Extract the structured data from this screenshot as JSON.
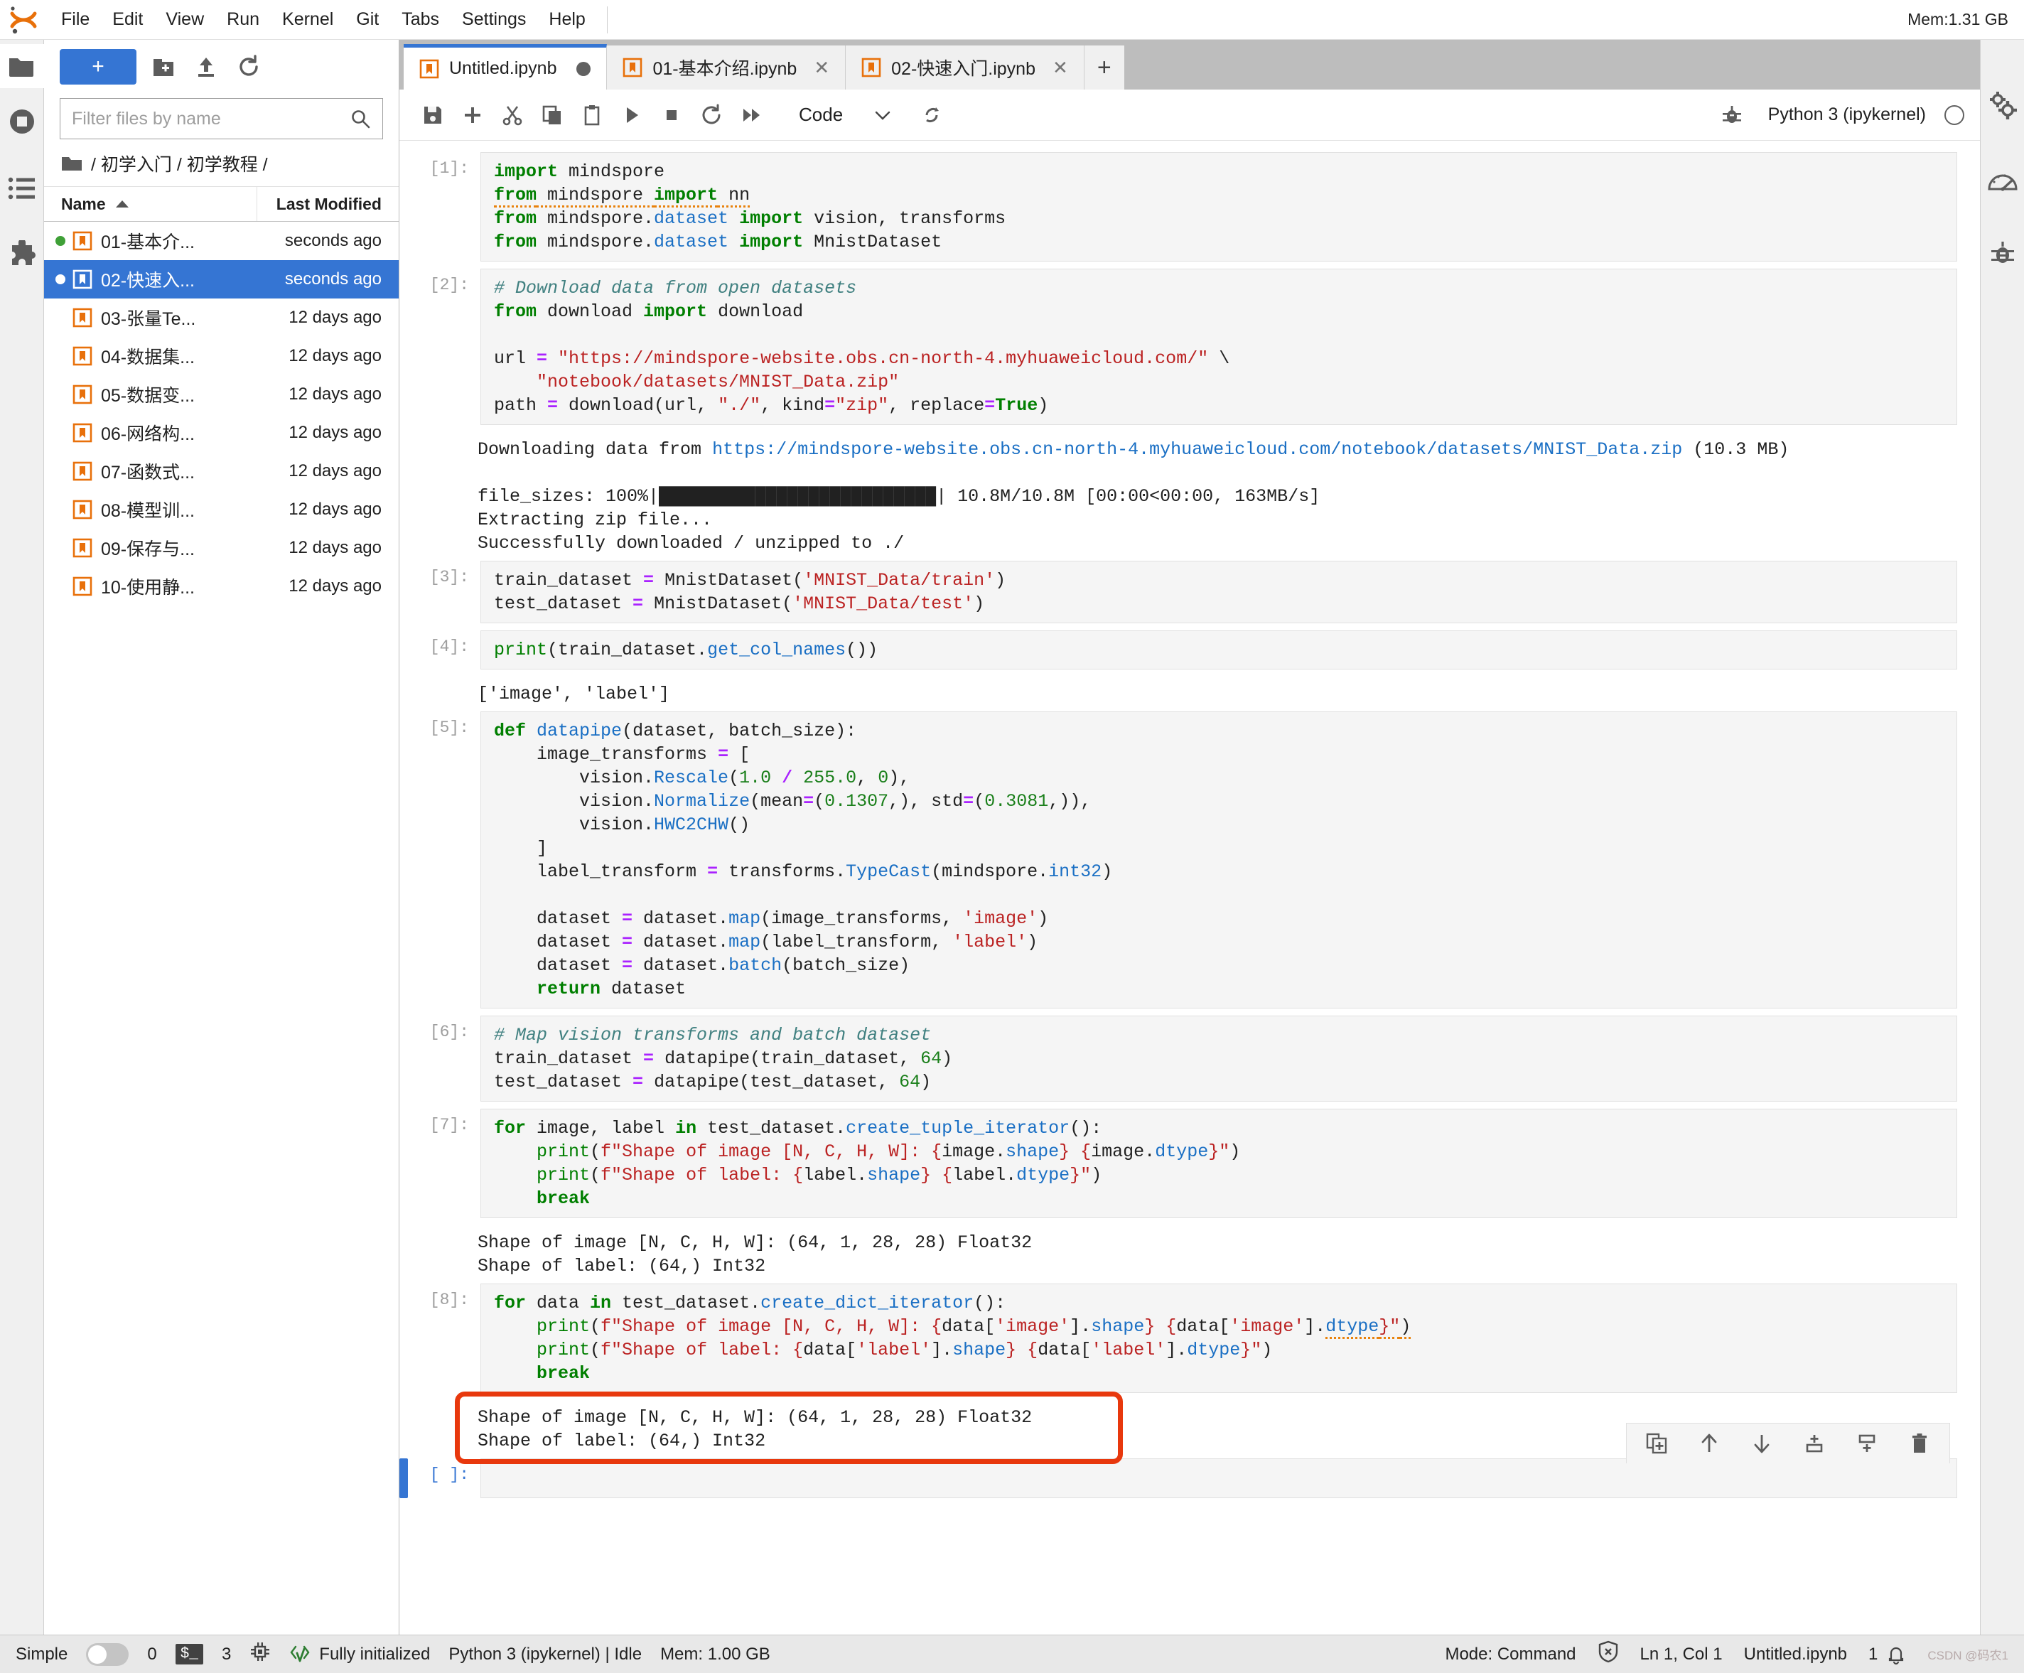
{
  "app": {
    "logo": "jupyter-logo",
    "memory_top": "Mem:1.31 GB"
  },
  "menubar": {
    "items": [
      {
        "label": "File"
      },
      {
        "label": "Edit"
      },
      {
        "label": "View"
      },
      {
        "label": "Run"
      },
      {
        "label": "Kernel"
      },
      {
        "label": "Git"
      },
      {
        "label": "Tabs"
      },
      {
        "label": "Settings"
      },
      {
        "label": "Help"
      }
    ]
  },
  "activitybar": {
    "items": [
      {
        "name": "file-browser-icon",
        "label": "File Browser"
      },
      {
        "name": "running-sessions-icon",
        "label": "Running Terminals and Kernels"
      },
      {
        "name": "table-of-contents-icon",
        "label": "Table of Contents"
      },
      {
        "name": "extension-manager-icon",
        "label": "Extension Manager"
      }
    ]
  },
  "rightbar": {
    "items": [
      {
        "name": "property-inspector-icon",
        "label": "Property Inspector"
      },
      {
        "name": "performance-gauge-icon",
        "label": "Performance"
      },
      {
        "name": "debugger-icon",
        "label": "Debugger"
      }
    ]
  },
  "filebrowser": {
    "new_launcher_label": "+",
    "toolbar_icons": [
      {
        "name": "new-folder-icon"
      },
      {
        "name": "upload-icon"
      },
      {
        "name": "refresh-icon"
      }
    ],
    "filter": {
      "placeholder": "Filter files by name",
      "value": ""
    },
    "breadcrumb": "/ 初学入门 / 初学教程 /",
    "columns": {
      "name": "Name",
      "modified": "Last Modified"
    },
    "sort_indicator": "ascending",
    "files": [
      {
        "name": "01-基本介...",
        "modified": "seconds ago",
        "running": true,
        "selected": false
      },
      {
        "name": "02-快速入...",
        "modified": "seconds ago",
        "running": true,
        "selected": true
      },
      {
        "name": "03-张量Te...",
        "modified": "12 days ago",
        "running": false,
        "selected": false
      },
      {
        "name": "04-数据集...",
        "modified": "12 days ago",
        "running": false,
        "selected": false
      },
      {
        "name": "05-数据变...",
        "modified": "12 days ago",
        "running": false,
        "selected": false
      },
      {
        "name": "06-网络构...",
        "modified": "12 days ago",
        "running": false,
        "selected": false
      },
      {
        "name": "07-函数式...",
        "modified": "12 days ago",
        "running": false,
        "selected": false
      },
      {
        "name": "08-模型训...",
        "modified": "12 days ago",
        "running": false,
        "selected": false
      },
      {
        "name": "09-保存与...",
        "modified": "12 days ago",
        "running": false,
        "selected": false
      },
      {
        "name": "10-使用静...",
        "modified": "12 days ago",
        "running": false,
        "selected": false
      }
    ]
  },
  "tabs": [
    {
      "label": "Untitled.ipynb",
      "active": true,
      "dirty": true,
      "closable": false
    },
    {
      "label": "01-基本介绍.ipynb",
      "active": false,
      "dirty": false,
      "closable": true
    },
    {
      "label": "02-快速入门.ipynb",
      "active": false,
      "dirty": false,
      "closable": true
    }
  ],
  "tab_add_label": "+",
  "notebook_toolbar": {
    "icons": [
      {
        "name": "save-icon"
      },
      {
        "name": "add-cell-icon"
      },
      {
        "name": "cut-icon"
      },
      {
        "name": "copy-icon"
      },
      {
        "name": "paste-icon"
      },
      {
        "name": "run-icon"
      },
      {
        "name": "stop-icon"
      },
      {
        "name": "restart-kernel-icon"
      },
      {
        "name": "restart-and-run-all-icon"
      }
    ],
    "celltype": "Code",
    "celltype_caret": "chevron-down-icon",
    "git_icon": "git-branch-icon",
    "debug_icon": "debugger-bug-icon",
    "kernel_name": "Python 3 (ipykernel)",
    "kernel_status": "idle"
  },
  "cells": [
    {
      "prompt": "[1]:",
      "source_html": "<span class=\"k\">import</span> mindspore\n<span class=\"k sq\">from</span><span class=\"sq\"> mindspore </span><span class=\"k sq\">import</span><span class=\"sq\"> nn</span>\n<span class=\"k\">from</span> mindspore.<span class=\"n\">dataset</span> <span class=\"k\">import</span> vision, transforms\n<span class=\"k\">from</span> mindspore.<span class=\"n\">dataset</span> <span class=\"k\">import</span> MnistDataset",
      "source_text": "import mindspore\nfrom mindspore import nn\nfrom mindspore.dataset import vision, transforms\nfrom mindspore.dataset import MnistDataset",
      "outputs": []
    },
    {
      "prompt": "[2]:",
      "source_html": "<span class=\"c\"># Download data from open datasets</span>\n<span class=\"k\">from</span> download <span class=\"k\">import</span> download\n\nurl <span class=\"o\">=</span> <span class=\"s\">\"https://mindspore-website.obs.cn-north-4.myhuaweicloud.com/\"</span> \\\n    <span class=\"s\">\"notebook/datasets/MNIST_Data.zip\"</span>\npath <span class=\"o\">=</span> download(url, <span class=\"s\">\"./\"</span>, kind<span class=\"o\">=</span><span class=\"s\">\"zip\"</span>, replace<span class=\"o\">=</span><span class=\"k\">True</span>)",
      "source_text": "# Download data from open datasets\nfrom download import download\n\nurl = \"https://mindspore-website.obs.cn-north-4.myhuaweicloud.com/\" \\\n    \"notebook/datasets/MNIST_Data.zip\"\npath = download(url, \"./\", kind=\"zip\", replace=True)",
      "outputs": [
        {
          "html": "Downloading data from <span class=\"lnk\">https://mindspore-website.obs.cn-north-4.myhuaweicloud.com/notebook/datasets/MNIST_Data.zip</span> (10.3 MB)\n\nfile_sizes: 100%|██████████████████████████| 10.8M/10.8M [00:00&lt;00:00, 163MB/s]\nExtracting zip file...\nSuccessfully downloaded / unzipped to ./",
          "text": "Downloading data from https://mindspore-website.obs.cn-north-4.myhuaweicloud.com/notebook/datasets/MNIST_Data.zip (10.3 MB)\n\nfile_sizes: 100%|██████████████████████████| 10.8M/10.8M [00:00<00:00, 163MB/s]\nExtracting zip file...\nSuccessfully downloaded / unzipped to ./"
        }
      ]
    },
    {
      "prompt": "[3]:",
      "source_html": "train_dataset <span class=\"o\">=</span> MnistDataset(<span class=\"s\">'MNIST_Data/train'</span>)\ntest_dataset <span class=\"o\">=</span> MnistDataset(<span class=\"s\">'MNIST_Data/test'</span>)",
      "source_text": "train_dataset = MnistDataset('MNIST_Data/train')\ntest_dataset = MnistDataset('MNIST_Data/test')",
      "outputs": []
    },
    {
      "prompt": "[4]:",
      "source_html": "<span class=\"kn\">print</span>(train_dataset.<span class=\"n\">get_col_names</span>())",
      "source_text": "print(train_dataset.get_col_names())",
      "outputs": [
        {
          "html": "['image', 'label']",
          "text": "['image', 'label']"
        }
      ]
    },
    {
      "prompt": "[5]:",
      "source_html": "<span class=\"k\">def</span> <span class=\"n\">datapipe</span>(dataset, batch_size):\n    image_transforms <span class=\"o\">=</span> [\n        vision.<span class=\"n\">Rescale</span>(<span class=\"nu\">1.0</span> <span class=\"o\">/</span> <span class=\"nu\">255.0</span>, <span class=\"nu\">0</span>),\n        vision.<span class=\"n\">Normalize</span>(mean<span class=\"o\">=</span>(<span class=\"nu\">0.1307</span>,), std<span class=\"o\">=</span>(<span class=\"nu\">0.3081</span>,)),\n        vision.<span class=\"n\">HWC2CHW</span>()\n    ]\n    label_transform <span class=\"o\">=</span> transforms.<span class=\"n\">TypeCast</span>(mindspore.<span class=\"n\">int32</span>)\n\n    dataset <span class=\"o\">=</span> dataset.<span class=\"n\">map</span>(image_transforms, <span class=\"s\">'image'</span>)\n    dataset <span class=\"o\">=</span> dataset.<span class=\"n\">map</span>(label_transform, <span class=\"s\">'label'</span>)\n    dataset <span class=\"o\">=</span> dataset.<span class=\"n\">batch</span>(batch_size)\n    <span class=\"k\">return</span> dataset",
      "source_text": "def datapipe(dataset, batch_size):\n    image_transforms = [\n        vision.Rescale(1.0 / 255.0, 0),\n        vision.Normalize(mean=(0.1307,), std=(0.3081,)),\n        vision.HWC2CHW()\n    ]\n    label_transform = transforms.TypeCast(mindspore.int32)\n\n    dataset = dataset.map(image_transforms, 'image')\n    dataset = dataset.map(label_transform, 'label')\n    dataset = dataset.batch(batch_size)\n    return dataset",
      "outputs": []
    },
    {
      "prompt": "[6]:",
      "source_html": "<span class=\"c\"># Map vision transforms and batch dataset</span>\ntrain_dataset <span class=\"o\">=</span> datapipe(train_dataset, <span class=\"nu\">64</span>)\ntest_dataset <span class=\"o\">=</span> datapipe(test_dataset, <span class=\"nu\">64</span>)",
      "source_text": "# Map vision transforms and batch dataset\ntrain_dataset = datapipe(train_dataset, 64)\ntest_dataset = datapipe(test_dataset, 64)",
      "outputs": []
    },
    {
      "prompt": "[7]:",
      "source_html": "<span class=\"k\">for</span> image, label <span class=\"k\">in</span> test_dataset.<span class=\"n\">create_tuple_iterator</span>():\n    <span class=\"kn\">print</span>(<span class=\"s\">f\"Shape of image [N, C, H, W]: {</span>image.<span class=\"n\">shape</span><span class=\"s\">} {</span>image.<span class=\"n\">dtype</span><span class=\"s\">}\"</span>)\n    <span class=\"kn\">print</span>(<span class=\"s\">f\"Shape of label: {</span>label.<span class=\"n\">shape</span><span class=\"s\">} {</span>label.<span class=\"n\">dtype</span><span class=\"s\">}\"</span>)\n    <span class=\"k\">break</span>",
      "source_text": "for image, label in test_dataset.create_tuple_iterator():\n    print(f\"Shape of image [N, C, H, W]: {image.shape} {image.dtype}\")\n    print(f\"Shape of label: {label.shape} {label.dtype}\")\n    break",
      "outputs": [
        {
          "html": "Shape of image [N, C, H, W]: (64, 1, 28, 28) Float32\nShape of label: (64,) Int32",
          "text": "Shape of image [N, C, H, W]: (64, 1, 28, 28) Float32\nShape of label: (64,) Int32"
        }
      ]
    },
    {
      "prompt": "[8]:",
      "source_html": "<span class=\"k\">for</span> data <span class=\"k\">in</span> test_dataset.<span class=\"n\">create_dict_iterator</span>():\n    <span class=\"kn\">print</span>(<span class=\"s\">f\"Shape of image [N, C, H, W]: {</span>data[<span class=\"s\">'image'</span>].<span class=\"n\">shape</span><span class=\"s\">} {</span>data[<span class=\"s\">'image'</span>].<span class=\"n sq\">dtype</span><span class=\"s sq\">}\"</span><span class=\"sq\">)</span>\n    <span class=\"kn\">print</span>(<span class=\"s\">f\"Shape of label: {</span>data[<span class=\"s\">'label'</span>].<span class=\"n\">shape</span><span class=\"s\">} {</span>data[<span class=\"s\">'label'</span>].<span class=\"n\">dtype</span><span class=\"s\">}\"</span>)\n    <span class=\"k\">break</span>",
      "source_text": "for data in test_dataset.create_dict_iterator():\n    print(f\"Shape of image [N, C, H, W]: {data['image'].shape} {data['image'].dtype}\")\n    print(f\"Shape of label: {data['label'].shape} {data['label'].dtype}\")\n    break",
      "outputs": [
        {
          "html": "Shape of image [N, C, H, W]: (64, 1, 28, 28) Float32\nShape of label: (64,) Int32",
          "text": "Shape of image [N, C, H, W]: (64, 1, 28, 28) Float32\nShape of label: (64,) Int32",
          "highlighted": true
        }
      ]
    },
    {
      "prompt": "[ ]:",
      "source_html": "",
      "source_text": "",
      "active": true,
      "outputs": []
    }
  ],
  "cell_toolbar": {
    "icons": [
      {
        "name": "duplicate-cell-icon"
      },
      {
        "name": "move-cell-up-icon"
      },
      {
        "name": "move-cell-down-icon"
      },
      {
        "name": "insert-cell-above-icon"
      },
      {
        "name": "insert-cell-below-icon"
      },
      {
        "name": "delete-cell-icon"
      }
    ]
  },
  "annotation": {
    "color": "#e8380d",
    "target": "cell-8-output"
  },
  "statusbar": {
    "simple_label": "Simple",
    "simple_on": false,
    "terminals_count": "0",
    "kernel_chip": "$_",
    "kernels_count": "3",
    "kernel_icon": "cpu-chip-icon",
    "init_icon": "code-check-icon",
    "init_status": "Fully initialized",
    "kernel_status": "Python 3 (ipykernel) | Idle",
    "memory": "Mem: 1.00 GB",
    "mode": "Mode: Command",
    "error_icon": "shield-x-icon",
    "cursor": "Ln 1, Col 1",
    "filename": "Untitled.ipynb",
    "notification_count": "1",
    "notification_icon": "bell-icon",
    "watermark": "CSDN @码农1"
  }
}
